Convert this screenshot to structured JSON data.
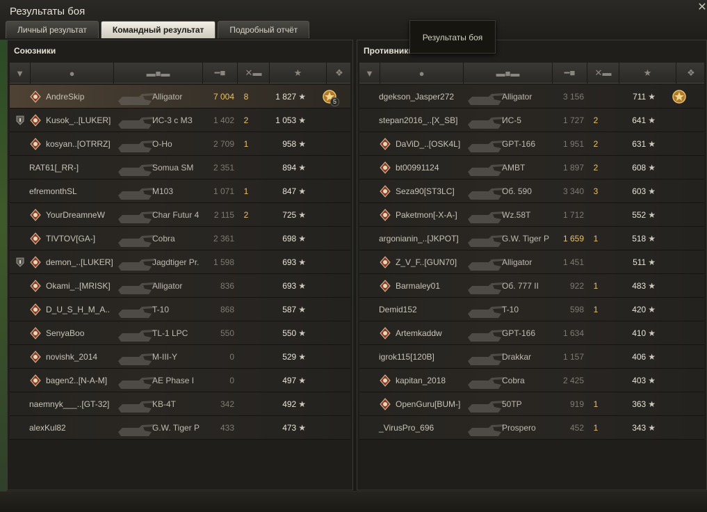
{
  "window": {
    "title": "Результаты боя",
    "close_icon": "close-icon"
  },
  "tabs": [
    {
      "label": "Личный результат",
      "active": false
    },
    {
      "label": "Командный результат",
      "active": true
    },
    {
      "label": "Подробный отчёт",
      "active": false
    }
  ],
  "tooltip": {
    "text": "Результаты боя"
  },
  "allies": {
    "title": "Союзники",
    "players": [
      {
        "name": "AndreSkip",
        "tank": "Alligator",
        "damage": "7 004",
        "kills": "8",
        "xp": "1 827",
        "me": true,
        "medal": "5"
      },
      {
        "name": "Kusok_..[LUKER]",
        "tank": "ИС-3 с МЗ",
        "damage": "1 402",
        "kills": "2",
        "xp": "1 053",
        "badge": true
      },
      {
        "name": "kosyan..[OTRRZ]",
        "tank": "O-Ho",
        "damage": "2 709",
        "kills": "1",
        "xp": "958"
      },
      {
        "name": "RAT61[_RR-]",
        "tank": "Somua SM",
        "damage": "2 351",
        "kills": "",
        "xp": "894",
        "noicon": true
      },
      {
        "name": "efremonthSL",
        "tank": "M103",
        "damage": "1 071",
        "kills": "1",
        "xp": "847",
        "noicon": true
      },
      {
        "name": "YourDreamneW",
        "tank": "Char Futur 4",
        "damage": "2 115",
        "kills": "2",
        "xp": "725"
      },
      {
        "name": "TIVTOV[GA-]",
        "tank": "Cobra",
        "damage": "2 361",
        "kills": "",
        "xp": "698"
      },
      {
        "name": "demon_..[LUKER]",
        "tank": "Jagdtiger Pr.",
        "damage": "1 598",
        "kills": "",
        "xp": "693",
        "badge": true
      },
      {
        "name": "Okami_..[MRISK]",
        "tank": "Alligator",
        "damage": "836",
        "kills": "",
        "xp": "693"
      },
      {
        "name": "D_U_S_H_M_A..",
        "tank": "T-10",
        "damage": "868",
        "kills": "",
        "xp": "587"
      },
      {
        "name": "SenyaBoo",
        "tank": "TL-1 LPC",
        "damage": "550",
        "kills": "",
        "xp": "550"
      },
      {
        "name": "novishk_2014",
        "tank": "M-III-Y",
        "damage": "0",
        "kills": "",
        "xp": "529"
      },
      {
        "name": "bagen2..[N-A-M]",
        "tank": "AE Phase I",
        "damage": "0",
        "kills": "",
        "xp": "497"
      },
      {
        "name": "naemnyk___..[GT-32]",
        "tank": "KB-4T",
        "damage": "342",
        "kills": "",
        "xp": "492",
        "noicon": true
      },
      {
        "name": "alexKul82",
        "tank": "G.W. Tiger P",
        "damage": "433",
        "kills": "",
        "xp": "473",
        "noicon": true
      }
    ]
  },
  "enemies": {
    "title": "Противники",
    "players": [
      {
        "name": "dgekson_Jasper272",
        "tank": "Alligator",
        "damage": "3 156",
        "kills": "",
        "xp": "711",
        "noicon": true,
        "medal": ""
      },
      {
        "name": "stepan2016_..[X_SB]",
        "tank": "ИС-5",
        "damage": "1 727",
        "kills": "2",
        "xp": "641",
        "noicon": true
      },
      {
        "name": "DaViD_..[OSK4L]",
        "tank": "GPT-166",
        "damage": "1 951",
        "kills": "2",
        "xp": "631"
      },
      {
        "name": "bt00991124",
        "tank": "AMBT",
        "damage": "1 897",
        "kills": "2",
        "xp": "608"
      },
      {
        "name": "Seza90[ST3LC]",
        "tank": "Об. 590",
        "damage": "3 340",
        "kills": "3",
        "xp": "603"
      },
      {
        "name": "Paketmon[-X-A-]",
        "tank": "Wz.58T",
        "damage": "1 712",
        "kills": "",
        "xp": "552"
      },
      {
        "name": "argonianin_..[JKPOT]",
        "tank": "G.W. Tiger P",
        "damage": "1 659",
        "kills": "1",
        "xp": "518",
        "noicon": true,
        "hl": true
      },
      {
        "name": "Z_V_F..[GUN70]",
        "tank": "Alligator",
        "damage": "1 451",
        "kills": "",
        "xp": "511"
      },
      {
        "name": "Barmaley01",
        "tank": "Об. 777 II",
        "damage": "922",
        "kills": "1",
        "xp": "483"
      },
      {
        "name": "Demid152",
        "tank": "T-10",
        "damage": "598",
        "kills": "1",
        "xp": "420",
        "noicon": true
      },
      {
        "name": "Artemkaddw",
        "tank": "GPT-166",
        "damage": "1 634",
        "kills": "",
        "xp": "410"
      },
      {
        "name": "igrok115[120B]",
        "tank": "Drakkar",
        "damage": "1 157",
        "kills": "",
        "xp": "406",
        "noicon": true
      },
      {
        "name": "kapitan_2018",
        "tank": "Cobra",
        "damage": "2 425",
        "kills": "",
        "xp": "403"
      },
      {
        "name": "OpenGuru[BUM-]",
        "tank": "50TP",
        "damage": "919",
        "kills": "1",
        "xp": "363"
      },
      {
        "name": "_VirusPro_696",
        "tank": "Prospero",
        "damage": "452",
        "kills": "1",
        "xp": "343",
        "noicon": true
      }
    ]
  },
  "columns": [
    "rank-icon",
    "player-icon",
    "tank-icon",
    "damage-icon",
    "kills-icon",
    "xp-star-icon",
    "medal-icon"
  ]
}
